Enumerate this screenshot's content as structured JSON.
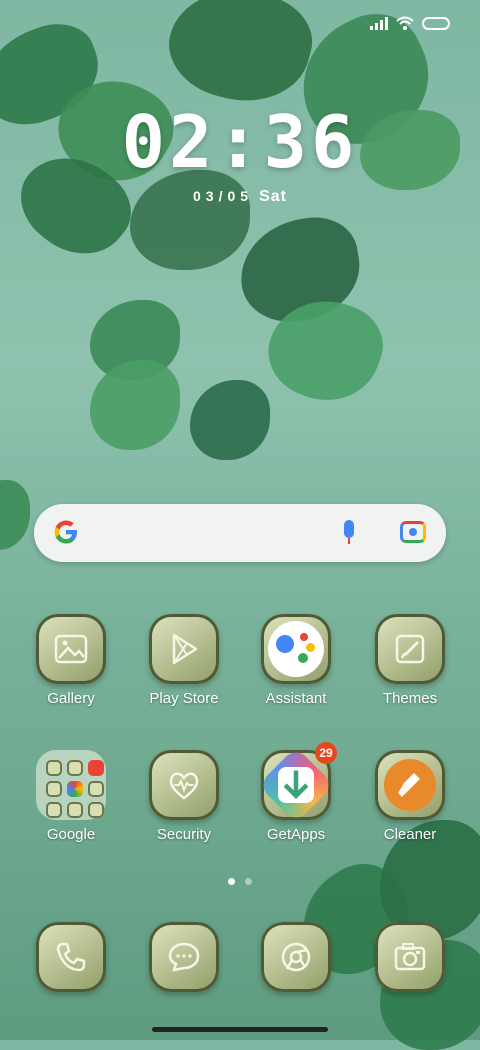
{
  "status_bar": {
    "signal_icon": "cell-signal-icon",
    "wifi_icon": "wifi-icon",
    "battery_icon": "battery-icon"
  },
  "clock": {
    "time": "02:36",
    "date": "03/05",
    "day": "Sat"
  },
  "search": {
    "logo": "G",
    "mic_icon": "microphone-icon",
    "lens_icon": "camera-lens-icon"
  },
  "apps_row1": [
    {
      "label": "Gallery",
      "icon": "image-icon"
    },
    {
      "label": "Play Store",
      "icon": "play-icon"
    },
    {
      "label": "Assistant",
      "icon": "assistant-icon"
    },
    {
      "label": "Themes",
      "icon": "brush-icon"
    }
  ],
  "apps_row2": [
    {
      "label": "Google",
      "icon": "folder-icon"
    },
    {
      "label": "Security",
      "icon": "heart-pulse-icon"
    },
    {
      "label": "GetApps",
      "icon": "download-icon",
      "badge": "29"
    },
    {
      "label": "Cleaner",
      "icon": "broom-icon"
    }
  ],
  "dock": [
    {
      "name": "phone",
      "icon": "phone-icon"
    },
    {
      "name": "messages",
      "icon": "message-icon"
    },
    {
      "name": "browser",
      "icon": "browser-icon"
    },
    {
      "name": "camera",
      "icon": "camera-icon"
    }
  ],
  "page_indicator": {
    "pages": 2,
    "current": 1
  },
  "colors": {
    "badge": "#e5481f",
    "icon_bg": "#b6c08a"
  }
}
